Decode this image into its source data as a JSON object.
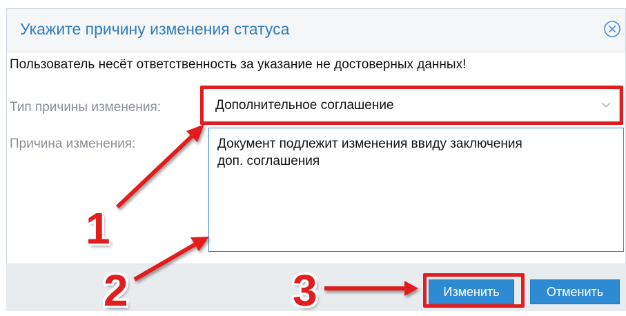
{
  "dialog": {
    "title": "Укажите причину изменения статуса",
    "close_icon": "close-circle-icon",
    "warning": "Пользователь несёт ответственность за указание не достоверных данных!",
    "reason_type": {
      "label": "Тип причины изменения:",
      "value": "Дополнительное соглашение"
    },
    "reason": {
      "label": "Причина изменения:",
      "value": "Документ подлежит изменения ввиду заключения\nдоп. соглашения"
    },
    "buttons": {
      "change": "Изменить",
      "cancel": "Отменить"
    }
  },
  "annotations": {
    "markers": [
      "1",
      "2",
      "3"
    ],
    "highlight_color": "#e21d1d"
  },
  "colors": {
    "accent": "#2f8ad4",
    "title": "#2f7ebd"
  }
}
